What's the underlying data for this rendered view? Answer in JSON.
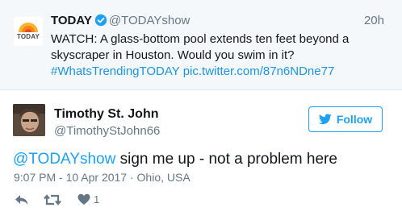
{
  "parent_tweet": {
    "logo_text": "TODAY",
    "name": "TODAY",
    "handle": "@TODAYshow",
    "time": "20h",
    "text": "WATCH: A glass-bottom pool extends ten feet beyond a skyscraper in Houston. Would you swim in it?",
    "hashtag": "#WhatsTrendingTODAY",
    "link": "pic.twitter.com/87n6NDne77"
  },
  "tweet": {
    "name": "Timothy St. John",
    "handle": "@TimothyStJohn66",
    "follow_label": "Follow",
    "mention": "@TODAYshow",
    "text": " sign me up - not a problem here",
    "meta": "9:07 PM - 10 Apr 2017 · Ohio, USA",
    "like_count": "1"
  },
  "icons": {
    "verified": "verified-badge-icon",
    "follow": "twitter-bird-icon",
    "reply": "reply-icon",
    "retweet": "retweet-icon",
    "like": "heart-icon"
  },
  "colors": {
    "accent": "#1da1f2",
    "link": "#1b95e0",
    "muted": "#657786",
    "parent_bg": "#f5f8fa"
  }
}
